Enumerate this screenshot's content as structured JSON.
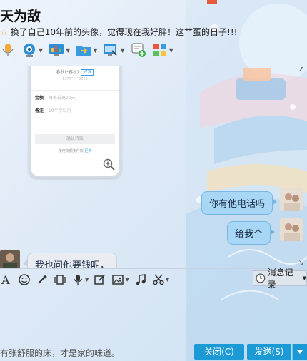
{
  "header": {
    "contact_name": "天为敌",
    "signature": "换了自己10年前的头像，觉得现在我好胖！这艹蛋的日子!!!"
  },
  "toolbar": {
    "items": [
      "voice-icon",
      "video-icon",
      "screen-share-icon",
      "file-transfer-icon",
      "remote-desktop-icon",
      "new-chat-icon",
      "app-grid-icon"
    ]
  },
  "chat": {
    "card": {
      "name": "春秋(*春秋)",
      "badge": "好友",
      "id": "1377****8828",
      "amount_label": "金额",
      "amount_placeholder": "每笔最高20元",
      "note_label": "备注",
      "note_placeholder": "10个字以内",
      "confirm": "确认转账",
      "footer": "使用余额支付款,",
      "footer_link": "更换"
    },
    "messages": [
      {
        "side": "right",
        "text": "你有他电话吗"
      },
      {
        "side": "right",
        "text": "给我个"
      },
      {
        "side": "left",
        "text": "我也问他要钱呢，"
      }
    ]
  },
  "input_toolbar": {
    "history_label": "消息记录"
  },
  "bottom": {
    "slogan": "有张舒服的床，才是家的味道。",
    "close_label": "关闭(C)",
    "send_label": "发送(S)"
  },
  "colors": {
    "primary_button": "#1b9ad6",
    "bubble_self": "#a8d6f5",
    "bubble_other": "#e9edf2"
  }
}
